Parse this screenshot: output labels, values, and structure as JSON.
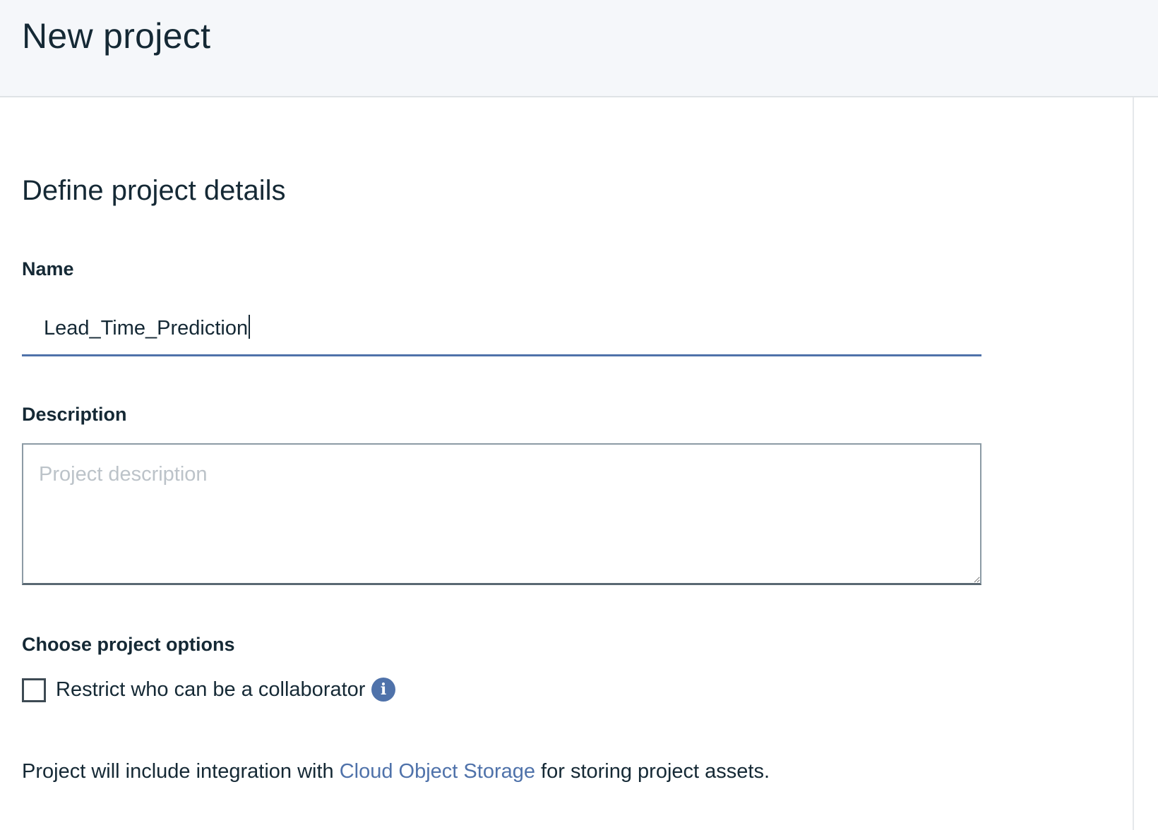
{
  "header": {
    "title": "New project"
  },
  "form": {
    "section_title": "Define project details",
    "name": {
      "label": "Name",
      "value": "Lead_Time_Prediction"
    },
    "description": {
      "label": "Description",
      "placeholder": "Project description",
      "value": ""
    },
    "options": {
      "label": "Choose project options",
      "restrict_collaborator": {
        "label": "Restrict who can be a collaborator",
        "checked": false
      },
      "info_icon": "info-icon"
    },
    "footer": {
      "prefix": "Project will include integration with ",
      "link_text": "Cloud Object Storage",
      "suffix": " for storing project assets."
    }
  },
  "colors": {
    "accent": "#4f72aa",
    "text": "#152935",
    "header_bg": "#f5f7fa"
  }
}
